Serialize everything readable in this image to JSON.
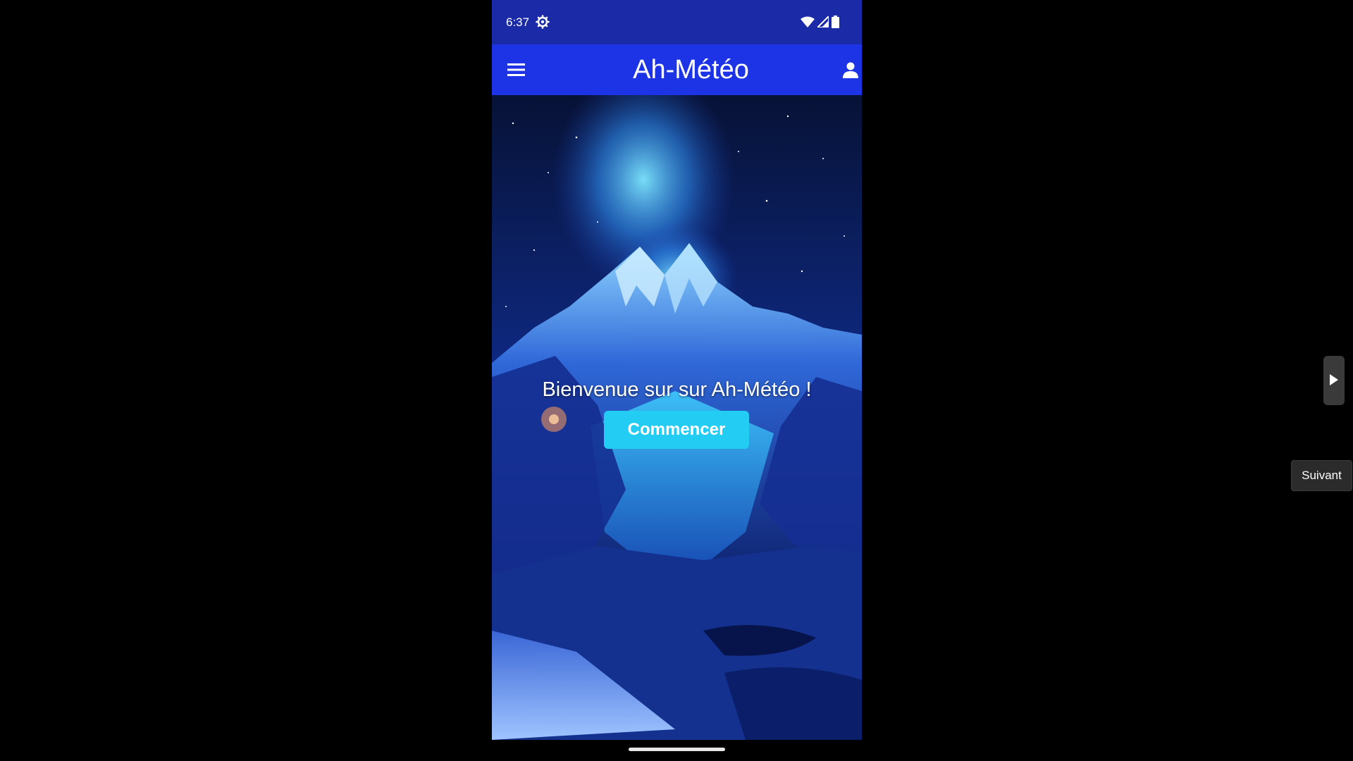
{
  "status_bar": {
    "time": "6:37",
    "settings_icon": "gear-icon",
    "wifi_icon": "wifi-icon",
    "signal_icon": "cell-signal-icon",
    "battery_icon": "battery-icon"
  },
  "app_bar": {
    "menu_icon": "hamburger-menu-icon",
    "title": "Ah-Météo",
    "profile_icon": "user-icon"
  },
  "hero": {
    "background": "mountain-night-sky-image",
    "welcome_text": "Bienvenue sur sur Ah-Météo !",
    "start_button_label": "Commencer"
  },
  "emulator": {
    "side_handle_icon": "play-arrow-icon",
    "tooltip": "Suivant"
  },
  "colors": {
    "status_bar": "#1b2aa6",
    "app_bar": "#1c34e6",
    "button": "#22ccf2",
    "text": "#ffffff"
  }
}
